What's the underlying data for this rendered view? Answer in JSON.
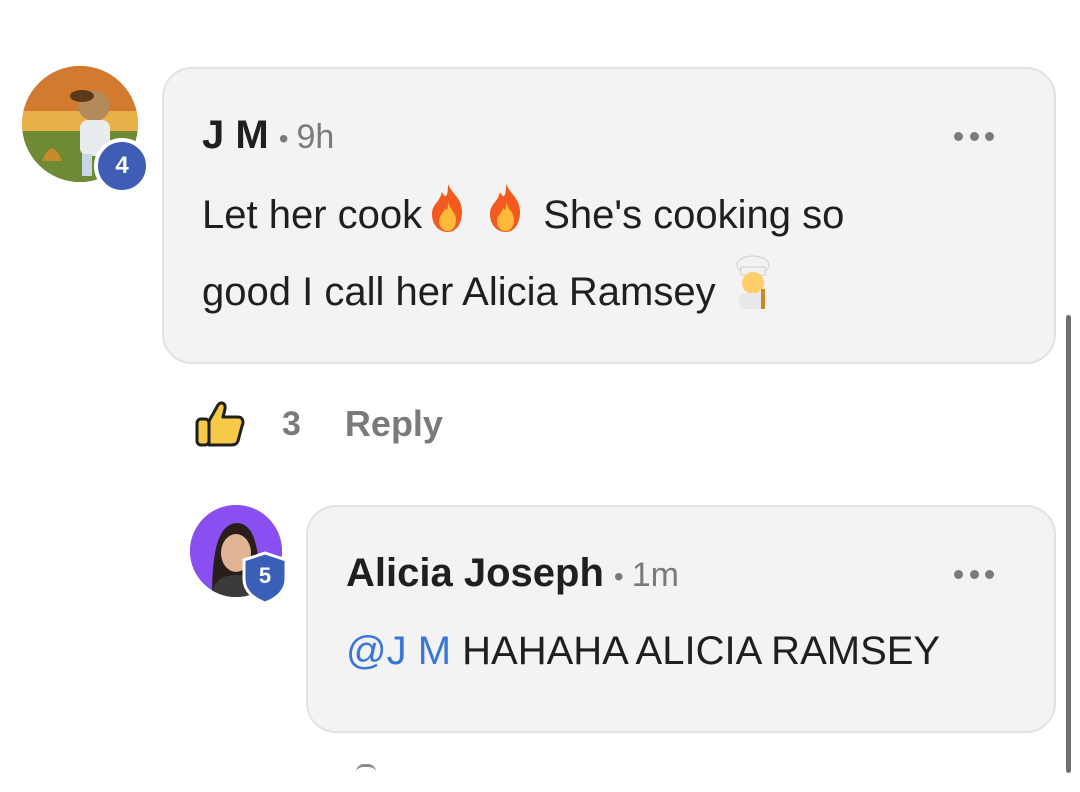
{
  "comments": [
    {
      "author": "J M",
      "separator": "•",
      "time": "9h",
      "level_badge": "4",
      "avatar_icon": "cartoon-character-avatar",
      "text_part1": "Let her cook",
      "text_part2": " She's cooking so",
      "text_line2": "good I call her Alicia Ramsey ",
      "emojis": [
        "fire-emoji",
        "fire-emoji",
        "chef-emoji"
      ],
      "likes": "3",
      "reply_label": "Reply"
    }
  ],
  "replies": [
    {
      "author": "Alicia Joseph",
      "separator": "•",
      "time": "1m",
      "level_badge": "5",
      "avatar_icon": "profile-photo-avatar",
      "mention": "@J M",
      "text": " HAHAHA ALICIA RAMSEY"
    }
  ],
  "colors": {
    "bubble_bg": "#f3f3f3",
    "mention": "#3a78d8",
    "badge_circle": "#3f5db4",
    "badge_shield": "#3a5fb8",
    "muted_text": "#7a7a7a"
  }
}
